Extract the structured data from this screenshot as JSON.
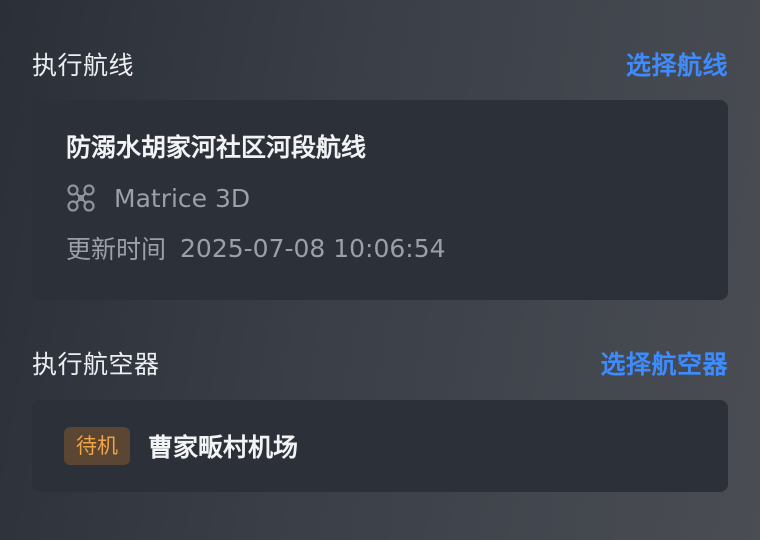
{
  "route_section": {
    "title": "执行航线",
    "select_label": "选择航线",
    "route_name": "防溺水胡家河社区河段航线",
    "drone_model": "Matrice 3D",
    "update_label": "更新时间",
    "update_time": "2025-07-08 10:06:54"
  },
  "aircraft_section": {
    "title": "执行航空器",
    "select_label": "选择航空器",
    "status_badge": "待机",
    "aircraft_name": "曹家畈村机场"
  },
  "colors": {
    "accent": "#3d8bfd",
    "badge_text": "#f0a446",
    "badge_bg": "#5a4632",
    "card_bg": "#2c3038"
  }
}
